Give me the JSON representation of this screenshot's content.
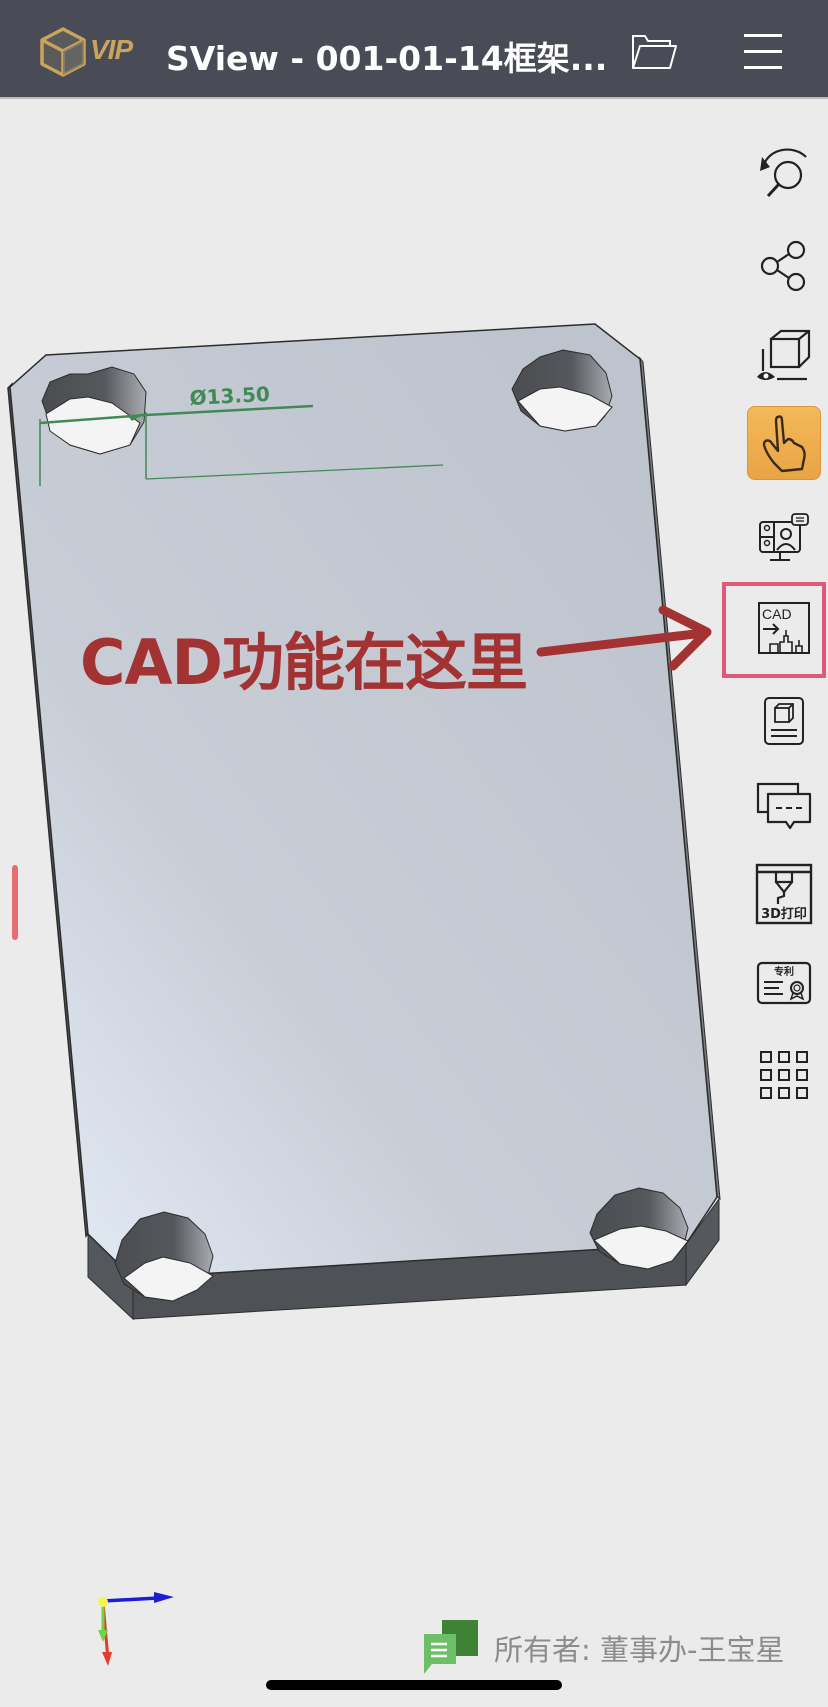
{
  "header": {
    "badge": "VIP",
    "title": "SView - 001-01-14框架..."
  },
  "model": {
    "dimension_label": "Ø13.50"
  },
  "annotation": {
    "text": "CAD功能在这里"
  },
  "toolbar": {
    "items": [
      {
        "name": "rotate-zoom",
        "label": ""
      },
      {
        "name": "share",
        "label": ""
      },
      {
        "name": "view",
        "label": ""
      },
      {
        "name": "gesture",
        "label": "",
        "active": true
      },
      {
        "name": "meeting",
        "label": ""
      },
      {
        "name": "cad",
        "label": "CAD"
      },
      {
        "name": "model-doc",
        "label": ""
      },
      {
        "name": "comments",
        "label": ""
      },
      {
        "name": "3d-print",
        "label": "3D打印"
      },
      {
        "name": "patent",
        "label": "专利"
      },
      {
        "name": "apps",
        "label": ""
      }
    ]
  },
  "footer": {
    "owner": "所有者: 董事办-王宝星"
  },
  "colors": {
    "header_bg": "#494c56",
    "accent_gold": "#c9a45c",
    "active_tool": "#f0b255",
    "highlight": "#dd5b78",
    "annotation": "#a33333",
    "dimension": "#3f8a55"
  }
}
